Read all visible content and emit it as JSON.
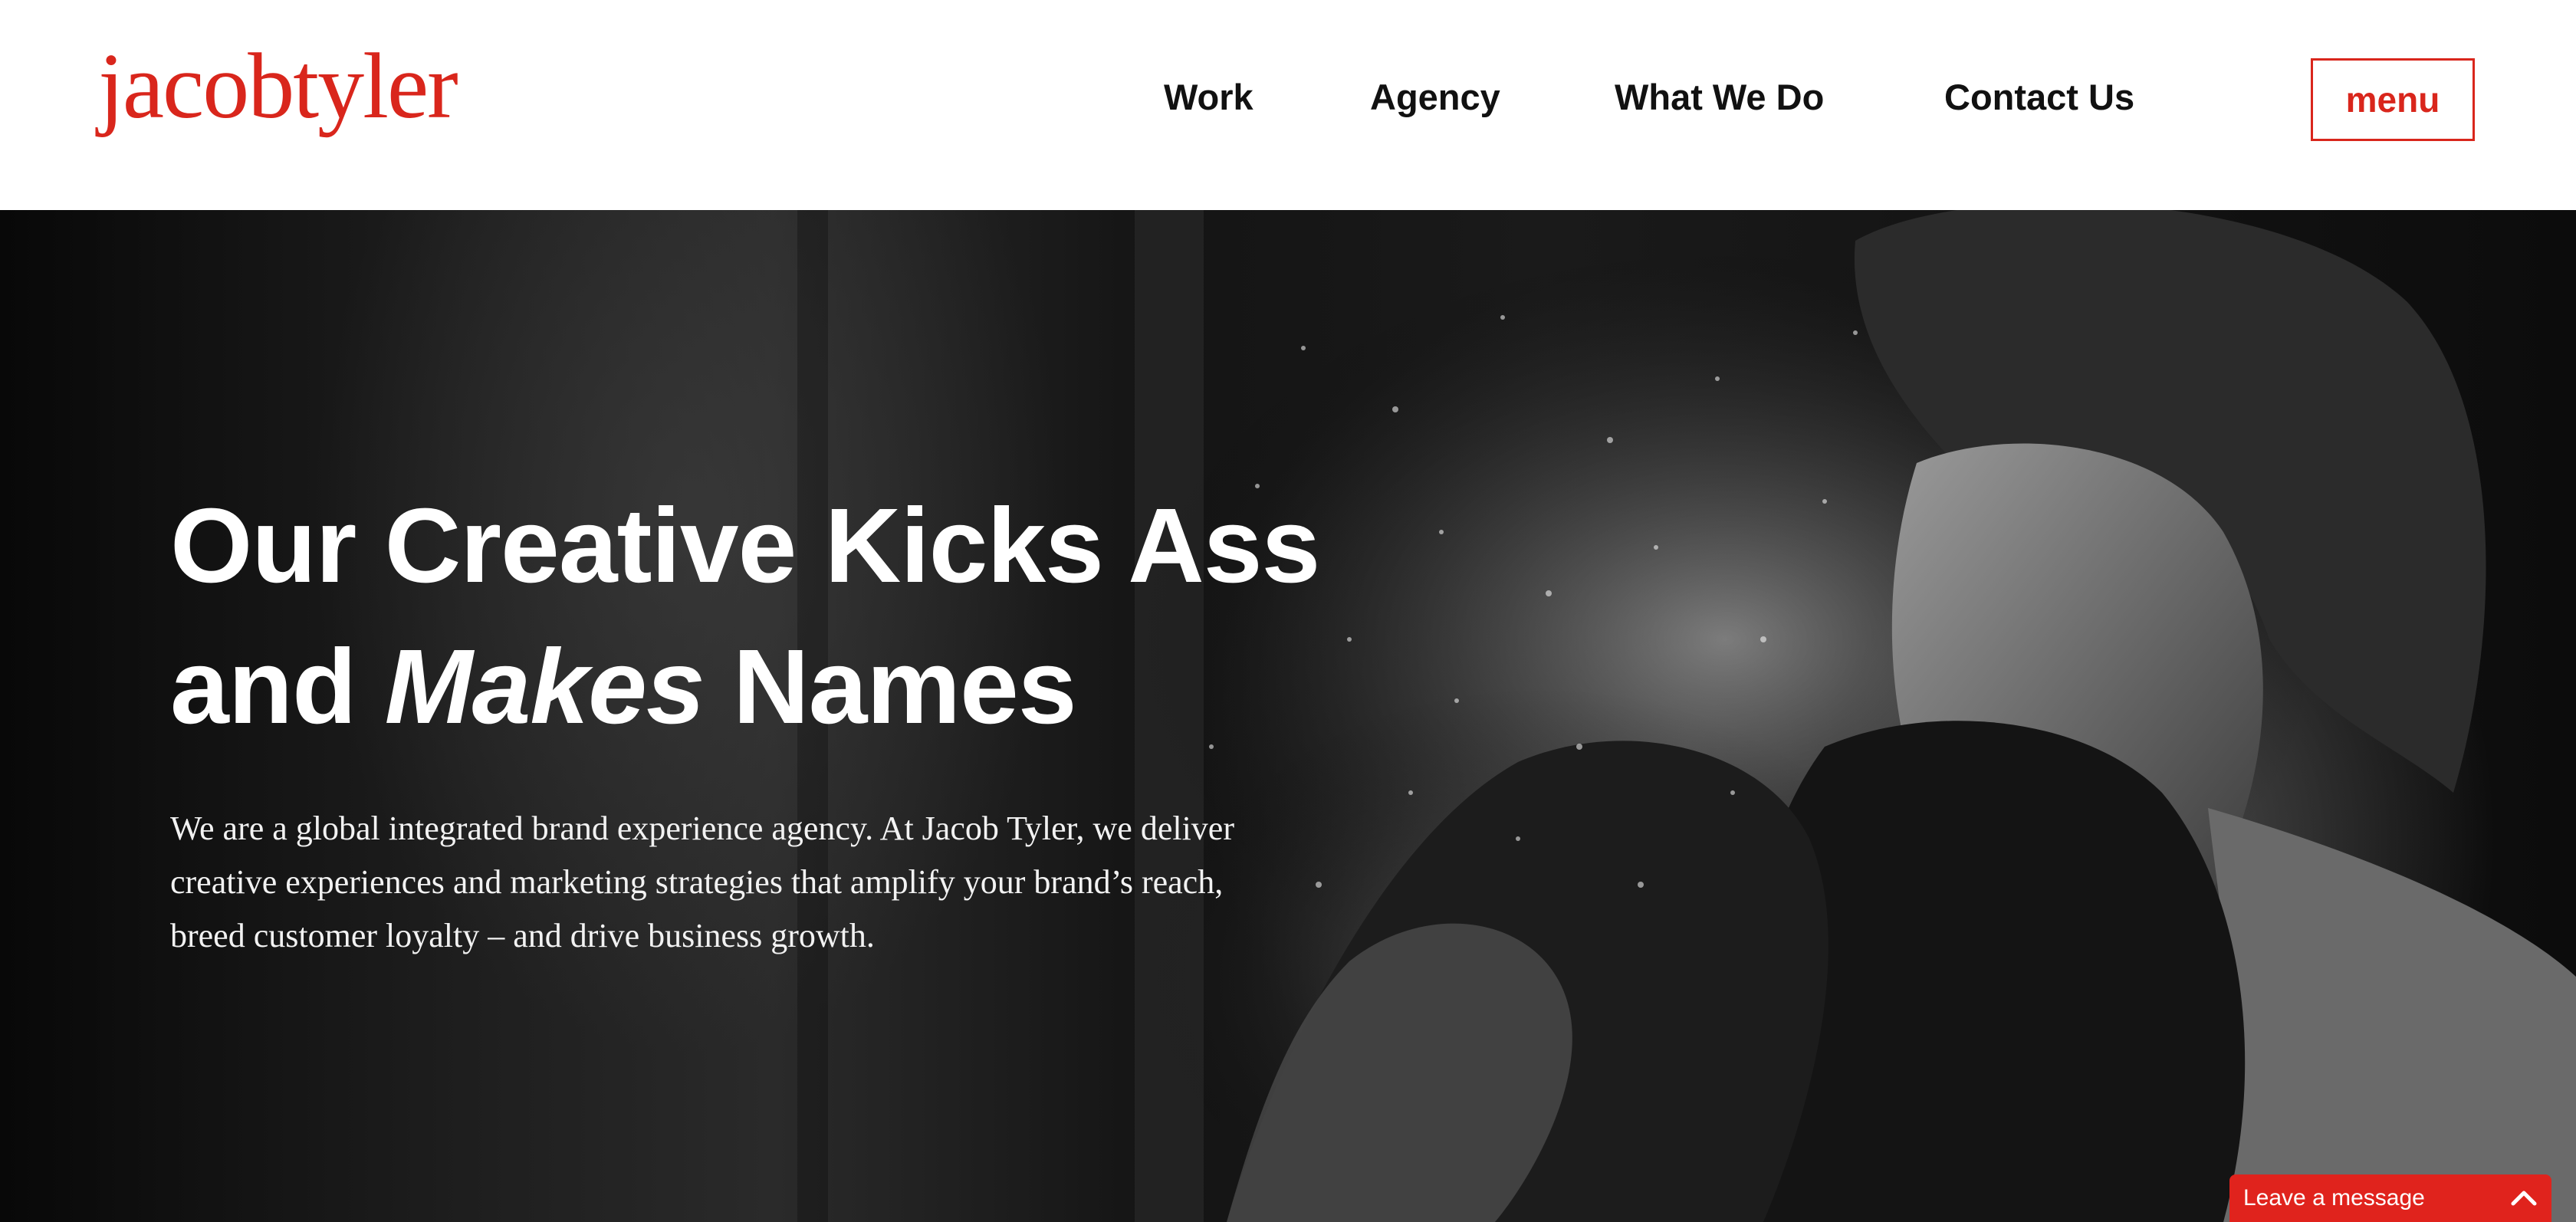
{
  "colors": {
    "brand_red": "#d9261c",
    "nav_text": "#111111",
    "hero_text": "#ffffff",
    "chat_red": "#e0231d"
  },
  "header": {
    "logo_text": "jacobtyler",
    "nav": [
      {
        "label": "Work"
      },
      {
        "label": "Agency"
      },
      {
        "label": "What We Do"
      },
      {
        "label": "Contact Us"
      }
    ],
    "menu_label": "menu"
  },
  "hero": {
    "headline_line1": "Our Creative Kicks Ass",
    "headline_line2_prefix": "and ",
    "headline_line2_emphasis": "Makes",
    "headline_line2_suffix": " Names",
    "body": "We are a global integrated brand experience agency. At Jacob Tyler, we deliver creative experiences and marketing strategies that amplify your brand’s reach, breed customer loyalty – and drive business growth.",
    "image_icon": "boxer-photo"
  },
  "chat": {
    "label": "Leave a message",
    "icon": "chevron-up-icon"
  }
}
